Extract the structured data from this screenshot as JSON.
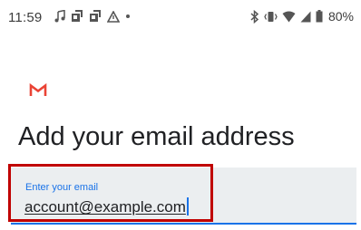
{
  "status_bar": {
    "time": "11:59",
    "battery_percent": "80%",
    "left_icons": [
      "music-note-icon",
      "notification-icon",
      "notification-icon",
      "warning-icon",
      "dot-icon"
    ],
    "right_icons": [
      "bluetooth-icon",
      "vibrate-icon",
      "wifi-icon",
      "signal-icon",
      "battery-icon"
    ]
  },
  "app": {
    "logo": "gmail-logo-icon",
    "brand_color": "#ea4335"
  },
  "page": {
    "title": "Add your email address"
  },
  "email_field": {
    "label": "Enter your email",
    "value": "account@example.com",
    "accent_color": "#1a73e8"
  },
  "highlight": {
    "color": "#c00000"
  }
}
